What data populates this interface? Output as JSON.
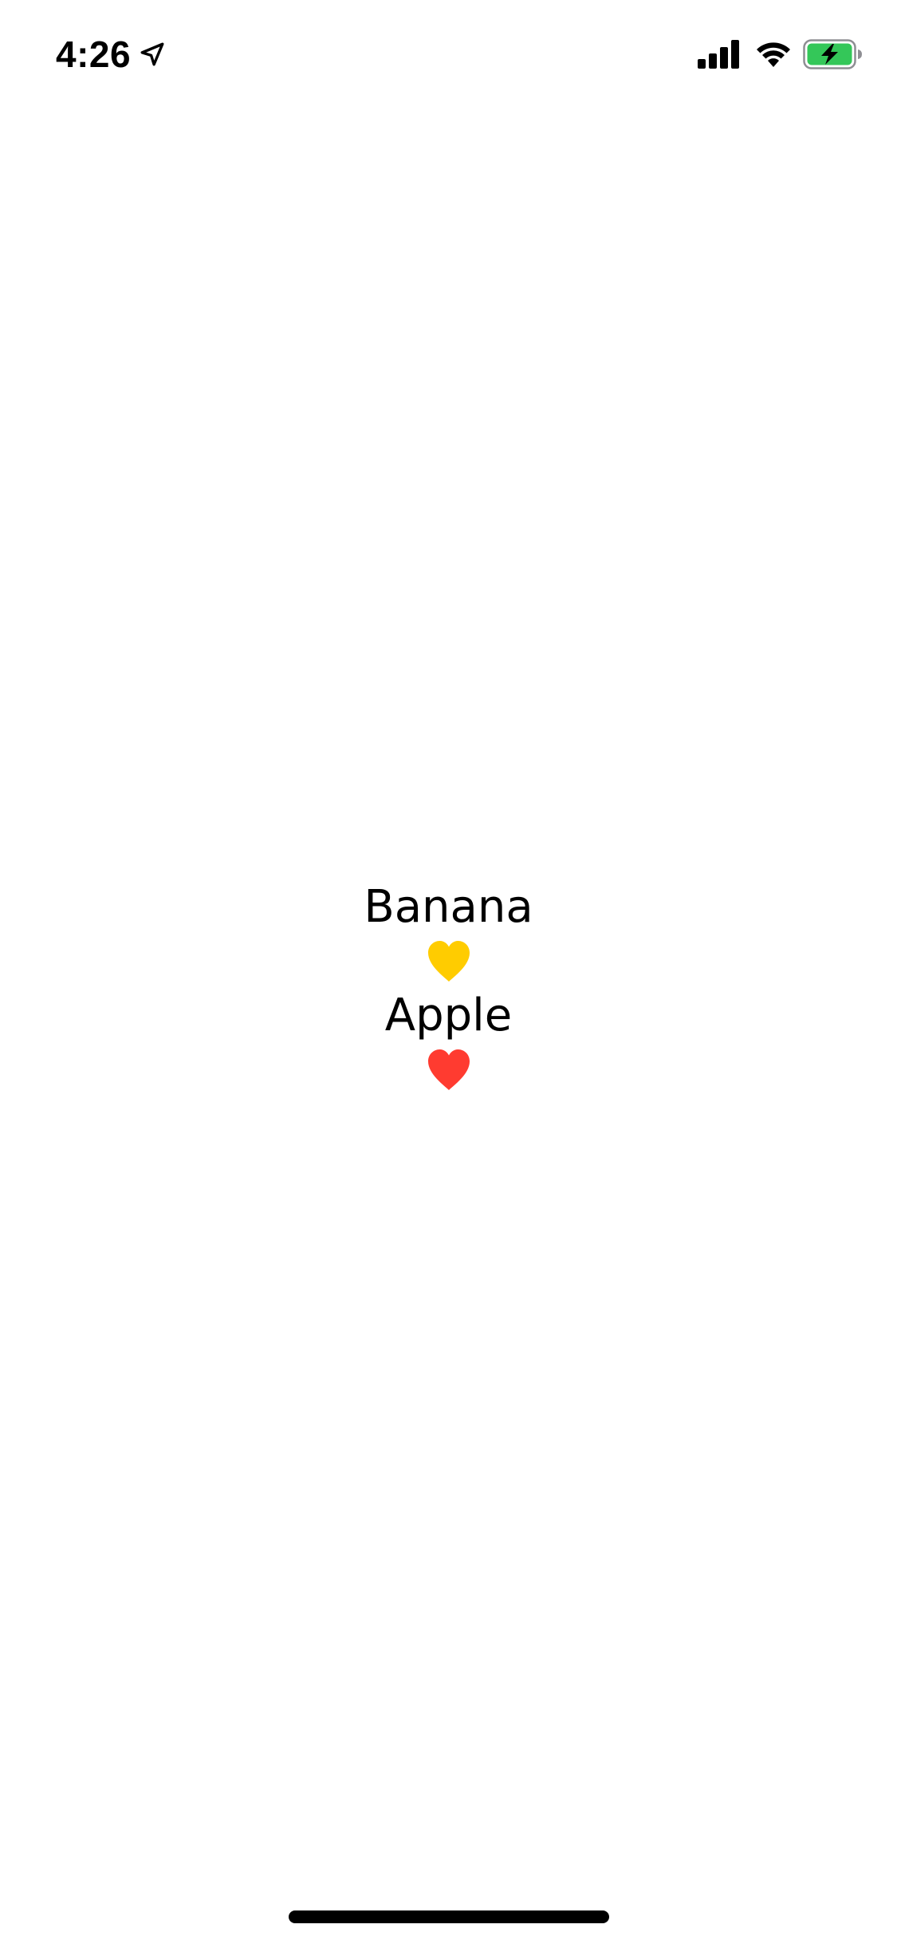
{
  "status_bar": {
    "time": "4:26",
    "location_icon": "location-arrow-icon",
    "signal_icon": "cellular-signal-icon",
    "wifi_icon": "wifi-icon",
    "battery_icon": "battery-charging-icon",
    "battery_color": "#34C759"
  },
  "main": {
    "items": [
      {
        "label": "Banana",
        "icon": "heart-icon",
        "color": "#FFCC00"
      },
      {
        "label": "Apple",
        "icon": "heart-icon",
        "color": "#FF3B30"
      }
    ]
  }
}
